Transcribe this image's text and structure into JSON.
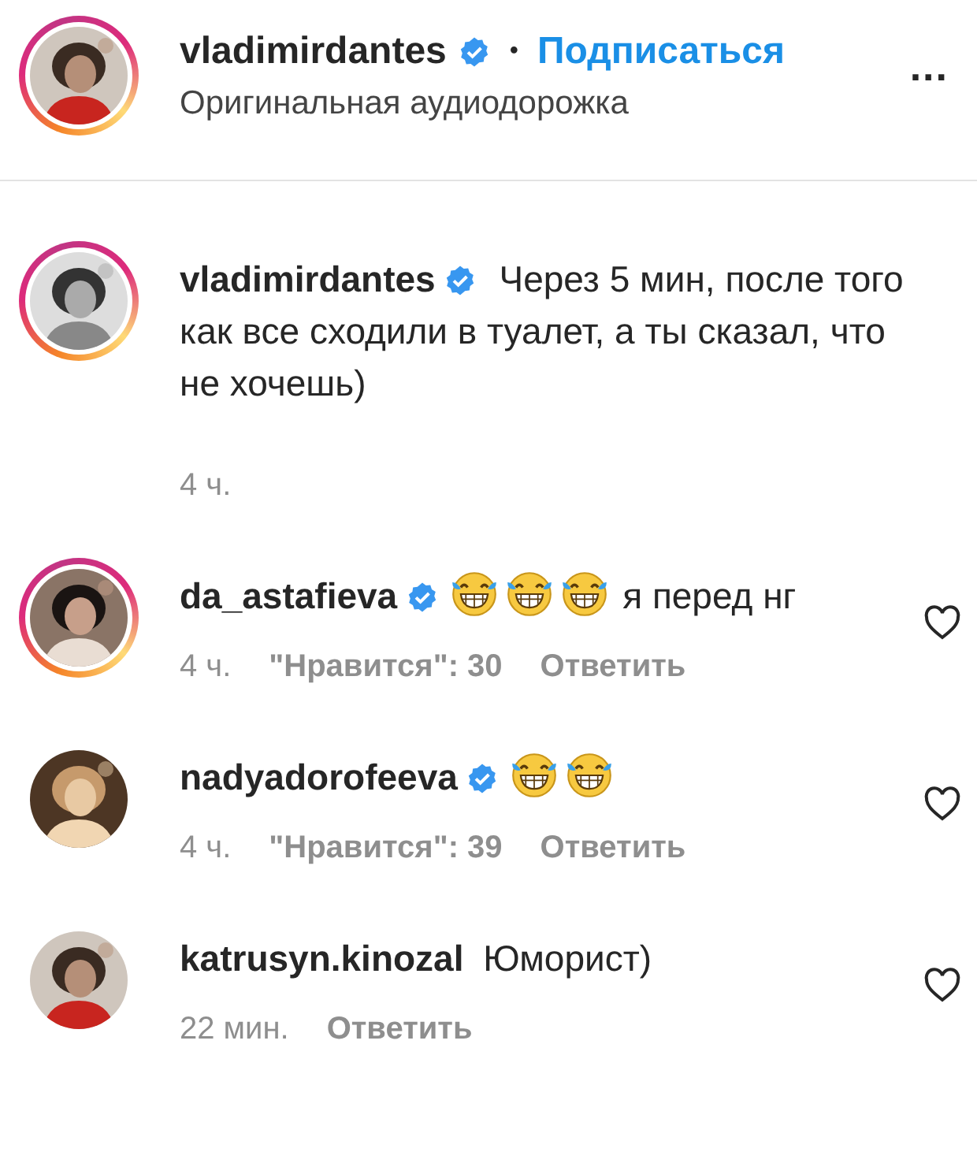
{
  "header": {
    "username": "vladimirdantes",
    "verified": true,
    "story_ring": true,
    "separator": "•",
    "follow": "Подписаться",
    "subtitle": "Оригинальная аудиодорожка",
    "more": "..."
  },
  "comments": [
    {
      "kind": "caption",
      "username": "vladimirdantes",
      "verified": true,
      "story_ring": true,
      "parts": [
        {
          "kind": "text",
          "text": "Через 5 мин, после того как все сходили в туалет, а ты сказал, что не хочешь)"
        }
      ],
      "time": "4 ч."
    },
    {
      "kind": "reply",
      "username": "da_astafieva",
      "verified": true,
      "story_ring": true,
      "parts": [
        {
          "kind": "emoji"
        },
        {
          "kind": "emoji"
        },
        {
          "kind": "emoji"
        },
        {
          "kind": "text",
          "text": "я перед нг"
        }
      ],
      "time": "4 ч.",
      "likes": "\"Нравится\": 30",
      "reply": "Ответить"
    },
    {
      "kind": "reply",
      "username": "nadyadorofeeva",
      "verified": true,
      "story_ring": false,
      "parts": [
        {
          "kind": "emoji"
        },
        {
          "kind": "emoji"
        }
      ],
      "time": "4 ч.",
      "likes": "\"Нравится\": 39",
      "reply": "Ответить"
    },
    {
      "kind": "reply",
      "username": "katrusyn.kinozal",
      "verified": false,
      "story_ring": false,
      "parts": [
        {
          "kind": "text",
          "text": "Юморист)"
        }
      ],
      "time": "22 мин.",
      "reply": "Ответить"
    }
  ]
}
